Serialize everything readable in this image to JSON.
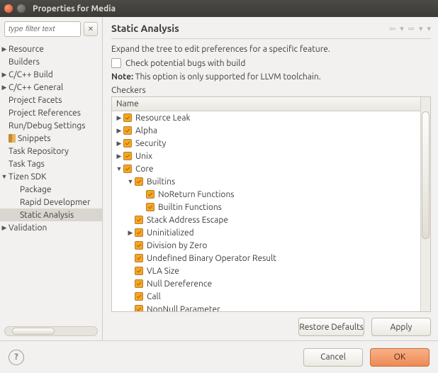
{
  "window": {
    "title": "Properties for Media"
  },
  "filter": {
    "placeholder": "type filter text"
  },
  "left_tree": [
    {
      "label": "Resource",
      "indent": 0,
      "twisty": "▶",
      "icon": null
    },
    {
      "label": "Builders",
      "indent": 0,
      "twisty": "",
      "icon": null
    },
    {
      "label": "C/C++ Build",
      "indent": 0,
      "twisty": "▶",
      "icon": null
    },
    {
      "label": "C/C++ General",
      "indent": 0,
      "twisty": "▶",
      "icon": null
    },
    {
      "label": "Project Facets",
      "indent": 0,
      "twisty": "",
      "icon": null
    },
    {
      "label": "Project References",
      "indent": 0,
      "twisty": "",
      "icon": null
    },
    {
      "label": "Run/Debug Settings",
      "indent": 0,
      "twisty": "",
      "icon": null
    },
    {
      "label": "Snippets",
      "indent": 0,
      "twisty": "",
      "icon": "snip"
    },
    {
      "label": "Task Repository",
      "indent": 0,
      "twisty": "",
      "icon": null
    },
    {
      "label": "Task Tags",
      "indent": 0,
      "twisty": "",
      "icon": null
    },
    {
      "label": "Tizen SDK",
      "indent": 0,
      "twisty": "▼",
      "icon": null
    },
    {
      "label": "Package",
      "indent": 1,
      "twisty": "",
      "icon": null
    },
    {
      "label": "Rapid Developmer",
      "indent": 1,
      "twisty": "",
      "icon": null
    },
    {
      "label": "Static Analysis",
      "indent": 1,
      "twisty": "",
      "icon": null,
      "selected": true
    },
    {
      "label": "Validation",
      "indent": 0,
      "twisty": "▶",
      "icon": null
    }
  ],
  "page": {
    "heading": "Static Analysis",
    "description": "Expand the tree to edit preferences for a specific feature.",
    "check_label": "Check potential bugs with build",
    "note_bold": "Note:",
    "note_rest": " This option is only supported for LLVM toolchain.",
    "checkers_label": "Checkers",
    "column_header": "Name"
  },
  "checkers": [
    {
      "label": "Resource Leak",
      "indent": 0,
      "twisty": "▶"
    },
    {
      "label": "Alpha",
      "indent": 0,
      "twisty": "▶"
    },
    {
      "label": "Security",
      "indent": 0,
      "twisty": "▶"
    },
    {
      "label": "Unix",
      "indent": 0,
      "twisty": "▶"
    },
    {
      "label": "Core",
      "indent": 0,
      "twisty": "▼"
    },
    {
      "label": "Builtins",
      "indent": 1,
      "twisty": "▼"
    },
    {
      "label": "NoReturn Functions",
      "indent": 2,
      "twisty": ""
    },
    {
      "label": "Builtin Functions",
      "indent": 2,
      "twisty": ""
    },
    {
      "label": "Stack Address Escape",
      "indent": 1,
      "twisty": ""
    },
    {
      "label": "Uninitialized",
      "indent": 1,
      "twisty": "▶"
    },
    {
      "label": "Division by Zero",
      "indent": 1,
      "twisty": ""
    },
    {
      "label": "Undefined Binary Operator Result",
      "indent": 1,
      "twisty": ""
    },
    {
      "label": "VLA Size",
      "indent": 1,
      "twisty": ""
    },
    {
      "label": "Null Dereference",
      "indent": 1,
      "twisty": ""
    },
    {
      "label": "Call",
      "indent": 1,
      "twisty": ""
    },
    {
      "label": "NonNull Parameter",
      "indent": 1,
      "twisty": ""
    }
  ],
  "buttons": {
    "restore": "Restore Defaults",
    "apply": "Apply",
    "cancel": "Cancel",
    "ok": "OK"
  }
}
